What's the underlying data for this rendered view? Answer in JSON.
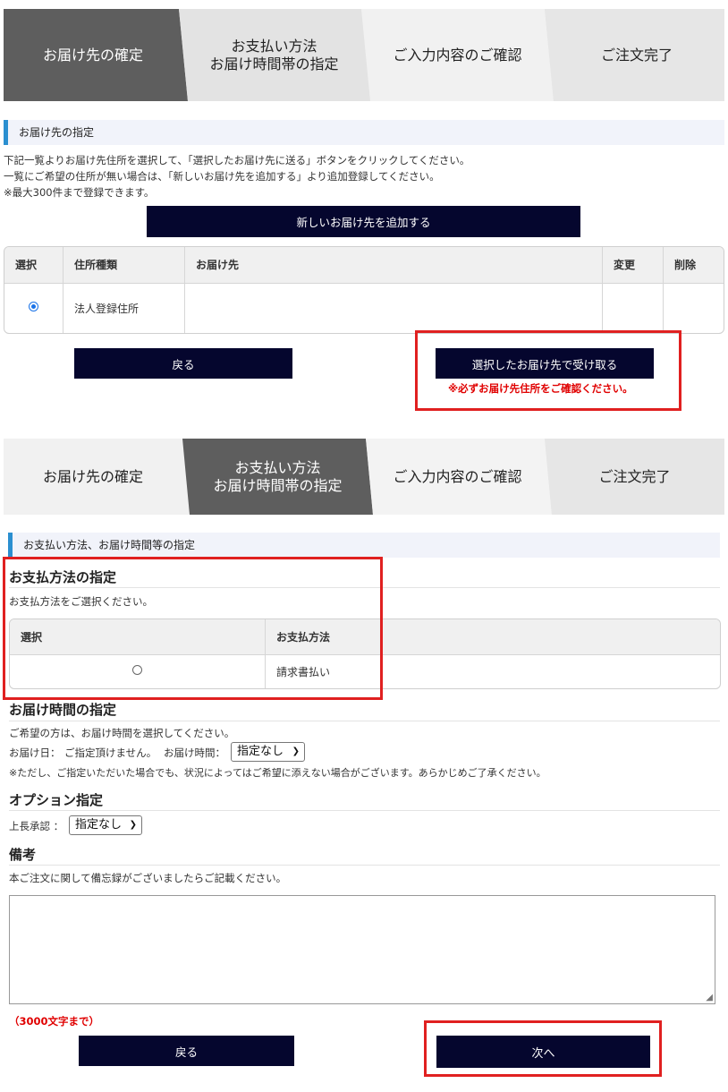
{
  "steps1": {
    "s1": "お届け先の確定",
    "s2a": "お支払い方法",
    "s2b": "お届け時間帯の指定",
    "s3": "ご入力内容のご確認",
    "s4": "ご注文完了"
  },
  "delivery": {
    "header": "お届け先の指定",
    "line1": "下記一覧よりお届け先住所を選択して、「選択したお届け先に送る」ボタンをクリックしてください。",
    "line2": "一覧にご希望の住所が無い場合は、「新しいお届け先を追加する」より追加登録してください。",
    "line3": "※最大300件まで登録できます。",
    "add_button": "新しいお届け先を追加する",
    "columns": [
      "選択",
      "住所種類",
      "お届け先",
      "変更",
      "削除"
    ],
    "row": {
      "type": "法人登録住所",
      "address": ""
    },
    "back_button": "戻る",
    "select_button": "選択したお届け先で受け取る",
    "warning": "※必ずお届け先住所をご確認ください。"
  },
  "steps2": {
    "s1": "お届け先の確定",
    "s2a": "お支払い方法",
    "s2b": "お届け時間帯の指定",
    "s3": "ご入力内容のご確認",
    "s4": "ご注文完了"
  },
  "payment": {
    "header": "お支払い方法、お届け時間等の指定",
    "title": "お支払方法の指定",
    "instruction": "お支払方法をご選択ください。",
    "columns": [
      "選択",
      "お支払方法"
    ],
    "method": "請求書払い"
  },
  "time": {
    "title": "お届け時間の指定",
    "instruction": "ご希望の方は、お届け時間を選択してください。",
    "date_label": "お届け日：",
    "date_value": "ご指定頂けません。",
    "time_label": "お届け時間：",
    "time_value": "指定なし",
    "note": "※ただし、ご指定いただいた場合でも、状況によってはご希望に添えない場合がございます。あらかじめご了承ください。"
  },
  "option": {
    "title": "オプション指定",
    "label": "上長承認 ：",
    "value": "指定なし"
  },
  "remarks": {
    "title": "備考",
    "instruction": "本ご注文に関して備忘録がございましたらご記載ください。",
    "value": "",
    "limit": "（3000文字まで）"
  },
  "footer": {
    "back_button": "戻る",
    "next_button": "次へ"
  },
  "colors": {
    "button_bg": "#05062e",
    "accent": "#2b8fd0",
    "highlight": "#e02020",
    "step_active": "#5e5e5e"
  }
}
